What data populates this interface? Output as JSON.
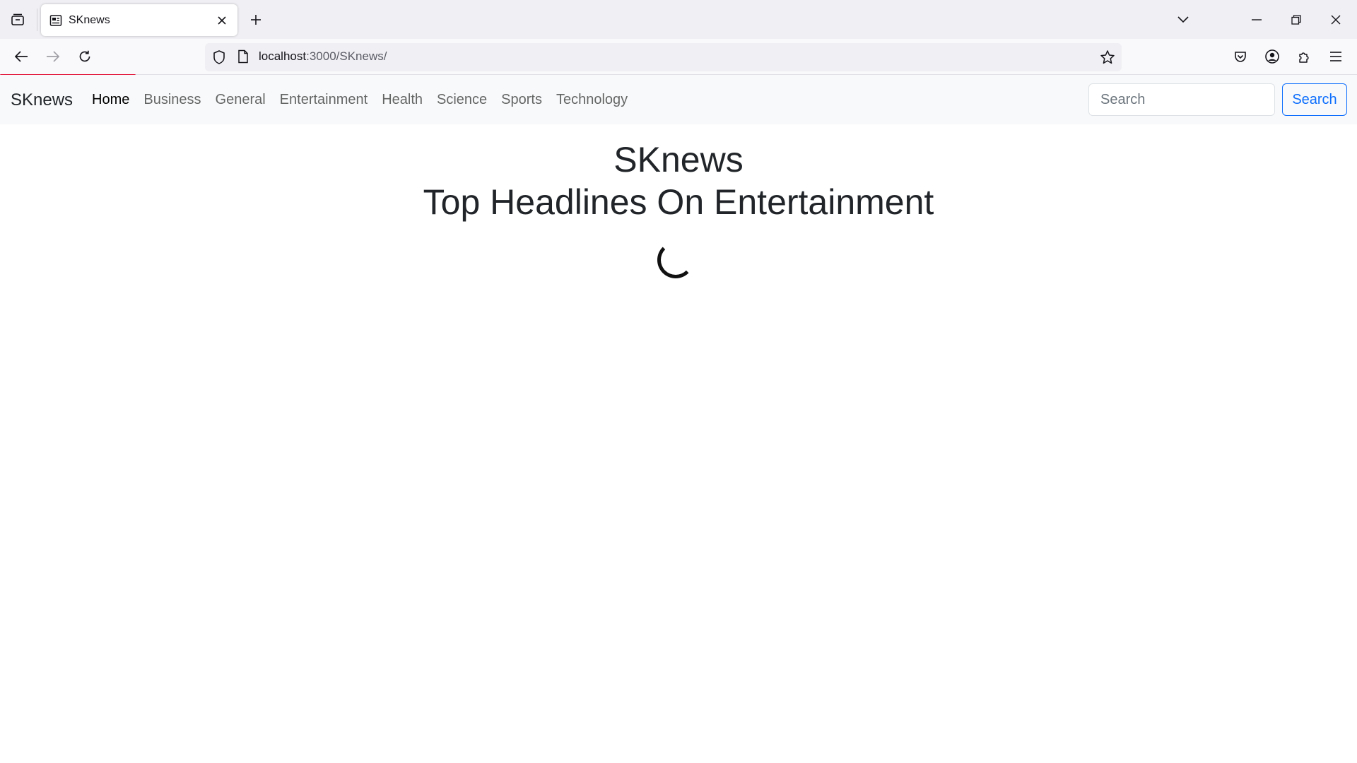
{
  "browser": {
    "tab_title": "SKnews",
    "url_host": "localhost",
    "url_path": ":3000/SKnews/"
  },
  "icons": {
    "tab_list": "tab-list-icon",
    "favicon": "news-icon",
    "close_tab": "close-icon",
    "new_tab": "plus-icon",
    "back": "arrow-left-icon",
    "forward": "arrow-right-icon",
    "reload": "reload-icon",
    "shield": "shield-icon",
    "page": "page-icon",
    "bookmark": "star-icon",
    "pocket": "pocket-icon",
    "account": "account-icon",
    "extensions": "puzzle-icon",
    "menu": "hamburger-icon"
  },
  "site": {
    "brand": "SKnews",
    "nav": [
      "Home",
      "Business",
      "General",
      "Entertainment",
      "Health",
      "Science",
      "Sports",
      "Technology"
    ],
    "search_placeholder": "Search",
    "search_button": "Search"
  },
  "main": {
    "title": "SKnews",
    "subtitle": "Top Headlines On Entertainment"
  },
  "colors": {
    "accent": "#0d6efd",
    "progress": "#e3173a"
  }
}
